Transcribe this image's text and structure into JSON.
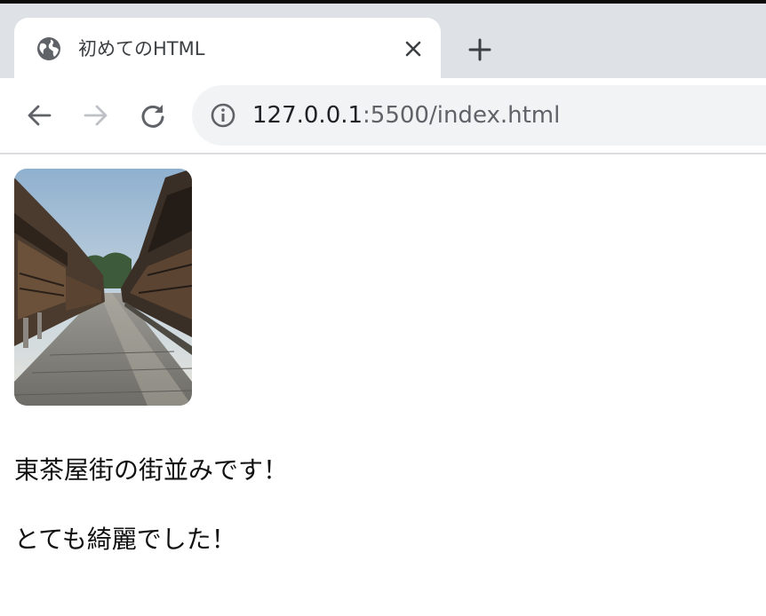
{
  "browser": {
    "tab": {
      "title": "初めてのHTML",
      "favicon_icon": "globe-icon",
      "close_icon": "close-icon"
    },
    "new_tab_icon": "plus-icon",
    "nav": {
      "back_icon": "back-arrow-icon",
      "forward_icon": "forward-arrow-icon",
      "reload_icon": "reload-icon"
    },
    "address_bar": {
      "info_icon": "info-icon",
      "host": "127.0.0.1",
      "rest": ":5500/index.html"
    }
  },
  "page": {
    "image": {
      "description_icon": "street-photo-image"
    },
    "paragraphs": [
      "東茶屋街の街並みです！",
      "とても綺麗でした！"
    ]
  },
  "colors": {
    "tabstrip_bg": "#dee1e6",
    "omnibox_bg": "#f1f3f4",
    "icon": "#5f6368",
    "icon_disabled": "#bdc1c6"
  }
}
